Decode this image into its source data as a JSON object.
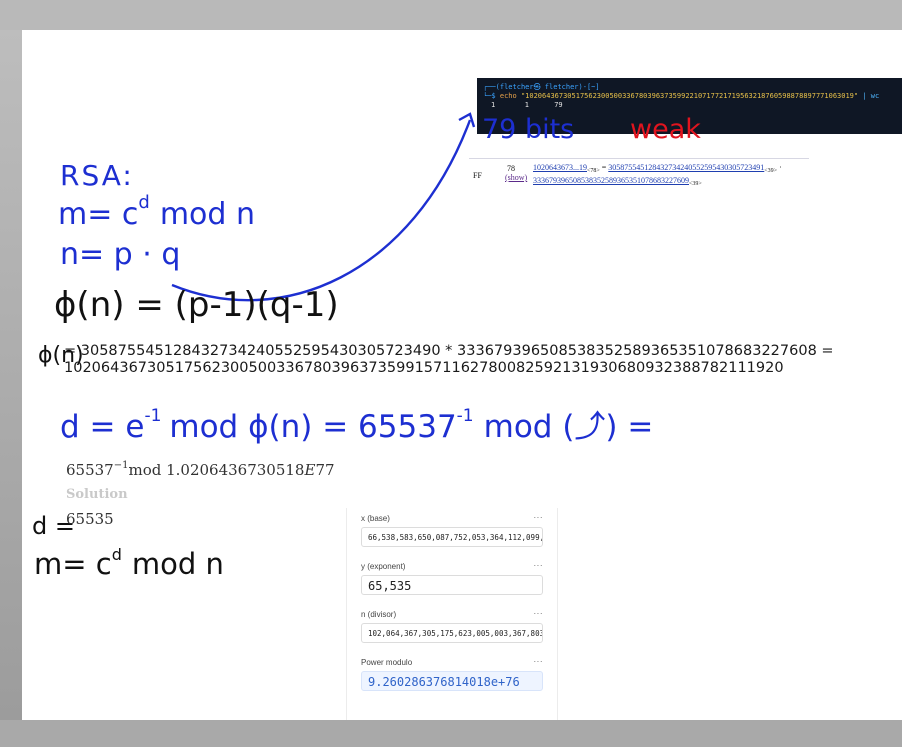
{
  "terminal": {
    "prompt_user": "(fletcher㉿ fletcher)-[~]",
    "prompt_symbol": "└─$",
    "command": "echo",
    "argument": "\"102064367305175623005003367803963735992210717721719563218760598878897771063019\"",
    "pipe": "| wc",
    "output": "1       1      79"
  },
  "factordb": {
    "status": "FF",
    "digits": "78",
    "show_link": "(show)",
    "number": "1020643673...19",
    "number_sub": "<78>",
    "equals": " = ",
    "factor1": "305875545128432734240552595430305723491",
    "factor1_sub": "<39>",
    "dot": " · ",
    "factor2": "333679396508538352589365351078683227609",
    "factor2_sub": "<39>"
  },
  "notes": {
    "bits_note": "79 bits",
    "weak_note": "weak",
    "rsa_title": "RSA:",
    "line_m": "m= c",
    "line_m_exp": "d",
    "line_m_rest": "mod n",
    "line_n": "n= p · q",
    "phi_formula": "ϕ(n) = (p-1)(q-1)",
    "phi_short": "ϕ(n)",
    "d_formula": "d = e",
    "d_exp": "-1",
    "d_formula_rest": "mod ϕ(n) = 65537",
    "d_exp2": "-1",
    "d_formula_end": "mod (⤴) =",
    "d_label": "d = ",
    "final_line": "m= c",
    "final_exp": "d",
    "final_rest": "mod n"
  },
  "phi_calc": {
    "line1": "= 305875545128432734240552595430305723490 * 333679396508538352589365351078683227608 =",
    "line2": "102064367305175623005003367803963735991571162780082592131930680932388782111920"
  },
  "modinv": {
    "base": "65537",
    "exp": "−1",
    "mod_word": "mod",
    "modulus": " 1.0206436730518",
    "modulus_e": "E",
    "modulus_exp": "77",
    "solution_label": "Solution",
    "solution_value": "65535"
  },
  "calculator": {
    "x_label": "x (base)",
    "x_value": "66,538,583,650,087,752,053,364,112,099,",
    "y_label": "y (exponent)",
    "y_value": "65,535",
    "n_label": "n (divisor)",
    "n_value": "102,064,367,305,175,623,005,003,367,803",
    "result_label": "Power modulo",
    "result_value": "9.260286376814018e+76",
    "menu_dots": "···"
  },
  "colors": {
    "ink_blue": "#1d2fd1",
    "ink_red": "#e0141e",
    "terminal_bg": "#0f1725"
  }
}
